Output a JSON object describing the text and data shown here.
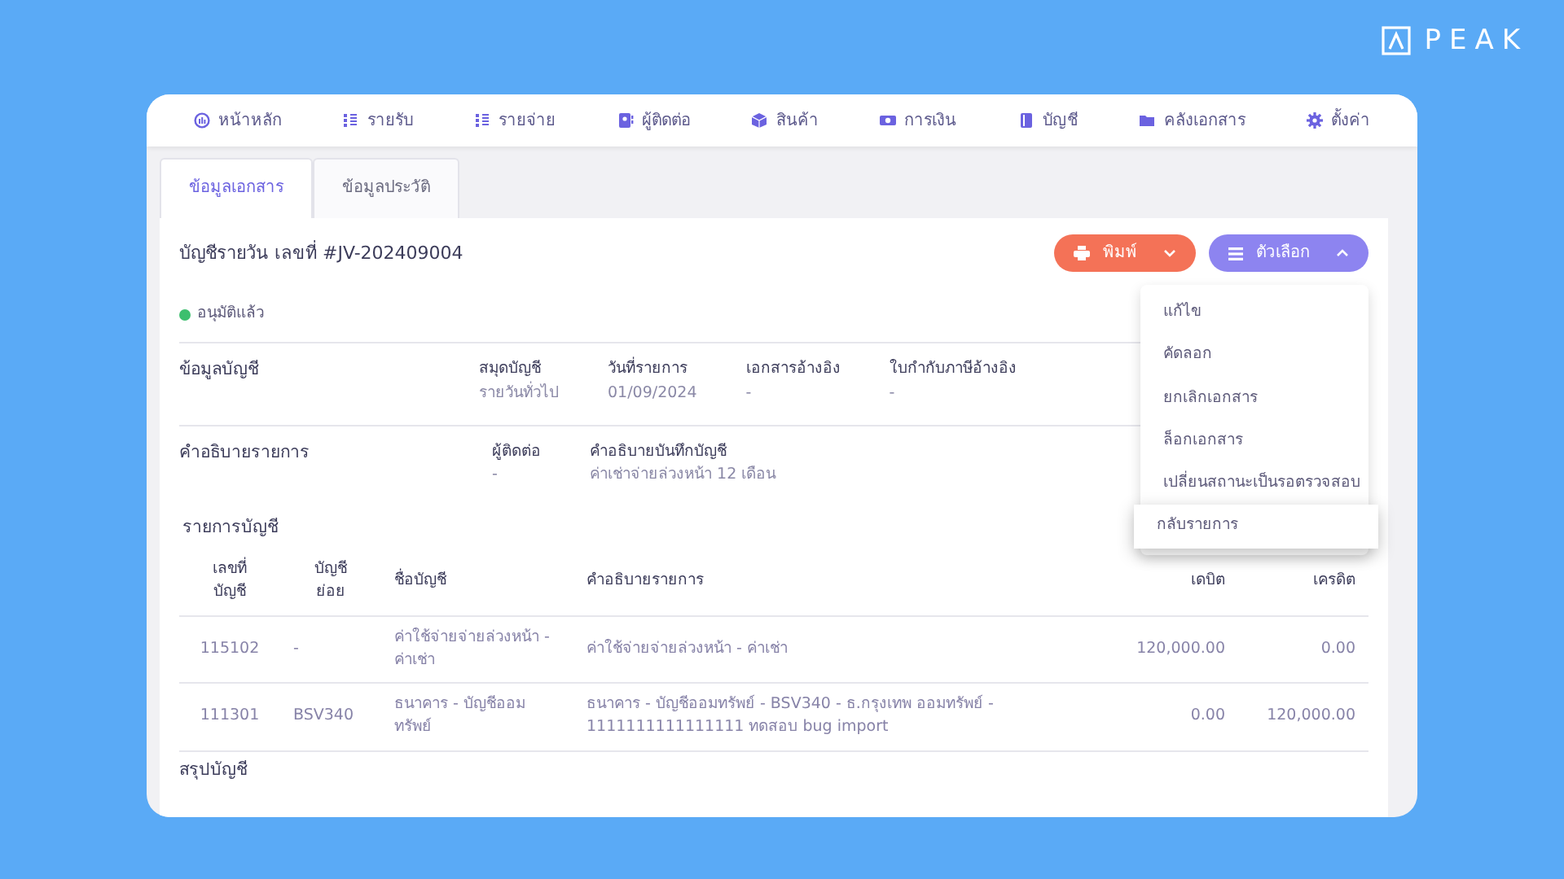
{
  "brand": {
    "name": "PEAK"
  },
  "nav": [
    {
      "label": "หน้าหลัก"
    },
    {
      "label": "รายรับ"
    },
    {
      "label": "รายจ่าย"
    },
    {
      "label": "ผู้ติดต่อ"
    },
    {
      "label": "สินค้า"
    },
    {
      "label": "การเงิน"
    },
    {
      "label": "บัญชี"
    },
    {
      "label": "คลังเอกสาร"
    },
    {
      "label": "ตั้งค่า"
    }
  ],
  "tabs": [
    {
      "label": "ข้อมูลเอกสาร",
      "selected": true
    },
    {
      "label": "ข้อมูลประวัติ",
      "selected": false
    }
  ],
  "document": {
    "title": "บัญชีรายวัน เลขที่ #JV-202409004",
    "status": {
      "label": "อนุมัติแล้ว",
      "color": "#3dbf6e"
    },
    "print_button": {
      "label": "พิมพ์"
    },
    "options_button": {
      "label": "ตัวเลือก",
      "expanded": true
    },
    "menu": [
      {
        "label": "แก้ไข",
        "selected": false
      },
      {
        "label": "คัดลอก",
        "selected": false
      },
      {
        "label": "ยกเลิกเอกสาร",
        "selected": false
      },
      {
        "label": "ล็อกเอกสาร",
        "selected": false
      },
      {
        "label": "เปลี่ยนสถานะเป็นรอตรวจสอบ",
        "selected": false
      },
      {
        "label": "กลับรายการ",
        "selected": true
      }
    ]
  },
  "sections": [
    {
      "heading": "ข้อมูลบัญชี",
      "fields": [
        {
          "label": "สมุดบัญชี",
          "value": "รายวันทั่วไป"
        },
        {
          "label": "วันที่รายการ",
          "value": "01/09/2024"
        },
        {
          "label": "เอกสารอ้างอิง",
          "value": "-"
        },
        {
          "label": "ใบกำกับภาษีอ้างอิง",
          "value": "-"
        }
      ]
    },
    {
      "heading": "คำอธิบายรายการ",
      "fields": [
        {
          "label": "ผู้ติดต่อ",
          "value": "-"
        },
        {
          "label": "คำอธิบายบันทึกบัญชี",
          "value": "ค่าเช่าจ่ายล่วงหน้า 12 เดือน"
        }
      ]
    }
  ],
  "entries": {
    "heading": "รายการบัญชี",
    "columns": [
      "เลขที่\nบัญชี",
      "บัญชี\nย่อย",
      "ชื่อบัญชี",
      "คำอธิบายรายการ",
      "เดบิต",
      "เครดิต"
    ],
    "rows": [
      [
        "115102",
        "-",
        "ค่าใช้จ่ายจ่ายล่วงหน้า - ค่าเช่า",
        "ค่าใช้จ่ายจ่ายล่วงหน้า - ค่าเช่า",
        "120,000.00",
        "0.00"
      ],
      [
        "111301",
        "BSV340",
        "ธนาคาร - บัญชีออมทรัพย์",
        "ธนาคาร - บัญชีออมทรัพย์ - BSV340 - ธ.กรุงเทพ ออมทรัพย์ - 1111111111111111 ทดสอบ bug import",
        "0.00",
        "120,000.00"
      ]
    ]
  },
  "summary": {
    "heading": "สรุปบัญชี"
  }
}
